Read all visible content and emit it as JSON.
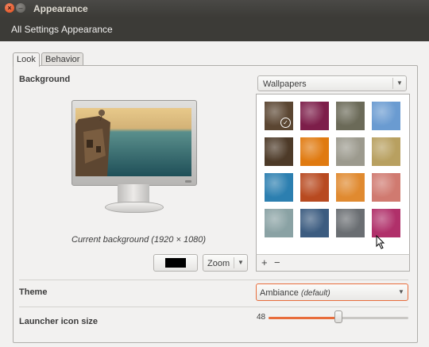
{
  "window": {
    "title": "Appearance"
  },
  "breadcrumbs": [
    "All Settings",
    "Appearance"
  ],
  "tabs": [
    "Look",
    "Behavior"
  ],
  "background": {
    "label": "Background",
    "source": "Wallpapers",
    "caption": "Current background (1920 × 1080)",
    "color": "#000000",
    "mode": "Zoom"
  },
  "wallpapers": {
    "selected_index": 0,
    "thumbnails": [
      "#5b4632",
      "#7d1e4a",
      "#6b6a58",
      "#6a9bd1",
      "#4d3a28",
      "#e07a10",
      "#9c9a8e",
      "#b8a060",
      "#2c7fb0",
      "#b84a20",
      "#e08a30",
      "#d07a70",
      "#8aa2a4",
      "#3c5c80",
      "#6a6e72",
      "#b0306a"
    ],
    "add_label": "+",
    "remove_label": "−"
  },
  "theme": {
    "label": "Theme",
    "value": "Ambiance",
    "suffix": "(default)"
  },
  "launcher": {
    "label": "Launcher icon size",
    "value": 48,
    "min": 32,
    "max": 64
  },
  "colors": {
    "accent": "#e86d3c",
    "titlebar": "#3c3b37"
  }
}
